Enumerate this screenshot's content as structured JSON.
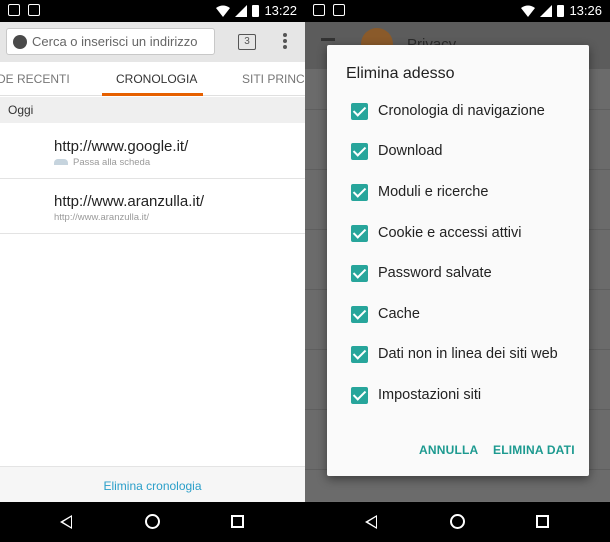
{
  "left": {
    "status": {
      "time": "13:22"
    },
    "urlbar": {
      "placeholder": "Cerca o inserisci un indirizzo",
      "tabs_count": "3"
    },
    "tabs": [
      {
        "label": "DE RECENTI"
      },
      {
        "label": "CRONOLOGIA",
        "active": true
      },
      {
        "label": "SITI PRINCI"
      }
    ],
    "section_title": "Oggi",
    "history": [
      {
        "title": "http://www.google.it/",
        "subtitle": "Passa alla scheda"
      },
      {
        "title": "http://www.aranzulla.it/",
        "subtitle": "http://www.aranzulla.it/"
      }
    ],
    "clear_history": "Elimina cronologia"
  },
  "right": {
    "status": {
      "time": "13:26"
    },
    "app_title": "Privacy",
    "dialog": {
      "title": "Elimina adesso",
      "options": [
        {
          "label": "Cronologia di navigazione",
          "checked": true
        },
        {
          "label": "Download",
          "checked": true
        },
        {
          "label": "Moduli e ricerche",
          "checked": true
        },
        {
          "label": "Cookie e accessi attivi",
          "checked": true
        },
        {
          "label": "Password salvate",
          "checked": true
        },
        {
          "label": "Cache",
          "checked": true
        },
        {
          "label": "Dati non in linea dei siti web",
          "checked": true
        },
        {
          "label": "Impostazioni siti",
          "checked": true
        }
      ],
      "cancel": "ANNULLA",
      "confirm": "ELIMINA DATI"
    }
  },
  "colors": {
    "accent_tab": "#e66000",
    "checkbox": "#27a59b",
    "link": "#2a9fc9"
  }
}
